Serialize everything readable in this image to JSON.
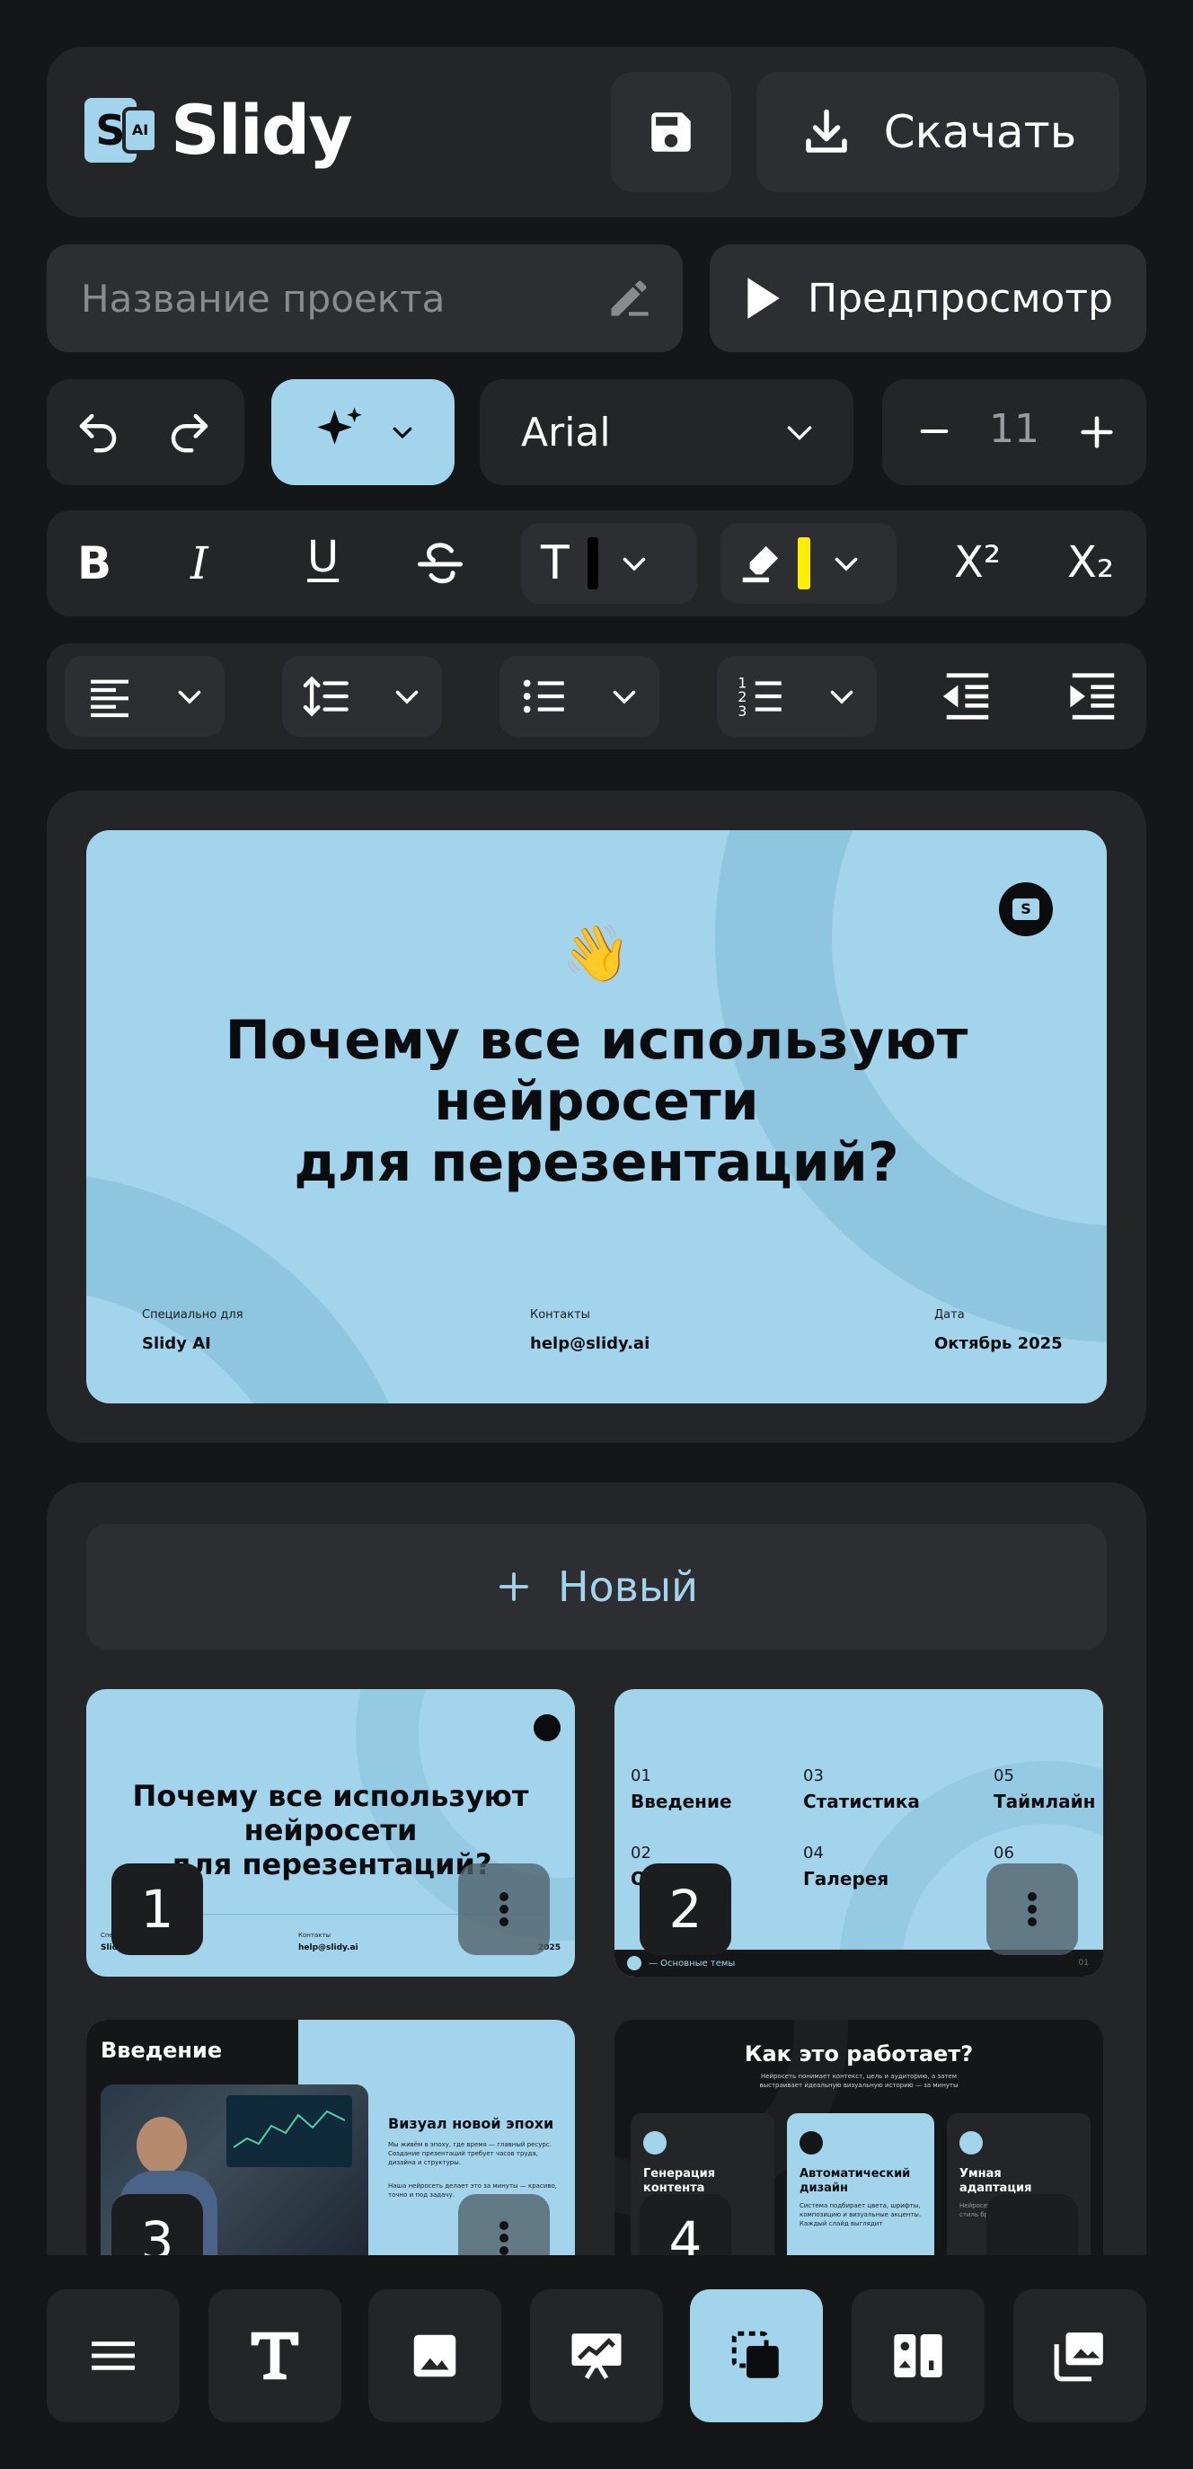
{
  "app": {
    "name": "Slidy",
    "logo_text": "S",
    "logo_badge": "AI"
  },
  "header": {
    "download_label": "Скачать"
  },
  "project": {
    "name_placeholder": "Название проекта",
    "preview_label": "Предпросмотр"
  },
  "toolbar": {
    "font_family": "Arial",
    "font_size": "11",
    "text_color": "#000000",
    "highlight_color": "#ffee00",
    "superscript_label": "X²",
    "subscript_label": "X₂"
  },
  "slide": {
    "emoji": "👋",
    "title": "Почему все используют\nнейросети\nдля перезентаций?",
    "meta": [
      {
        "label": "Специально для",
        "value": "Slidy AI"
      },
      {
        "label": "Контакты",
        "value": "help@slidy.ai"
      },
      {
        "label": "Дата",
        "value": "Октябрь 2025"
      }
    ]
  },
  "slides_panel": {
    "new_label": "Новый",
    "thumbs": [
      {
        "number": "1",
        "title": "Почему все используют\nнейросети\nдля перезентаций?",
        "meta_left": "Специально для",
        "meta_left_value": "Slidy AI",
        "meta_mid": "Контакты",
        "meta_mid_value": "help@slidy.ai",
        "meta_right_value": "2025"
      },
      {
        "number": "2",
        "toc": [
          {
            "num": "01",
            "title": "Введение"
          },
          {
            "num": "03",
            "title": "Статистика"
          },
          {
            "num": "05",
            "title": "Таймлайн"
          },
          {
            "num": "02",
            "title": "О"
          },
          {
            "num": "04",
            "title": "Галерея"
          },
          {
            "num": "06",
            "title": ""
          }
        ],
        "footer": "— Основные темы",
        "page": "01"
      },
      {
        "number": "3",
        "heading": "Введение",
        "sub": "Визуал новой эпохи",
        "p1": "Мы живём в эпоху, где время — главный ресурс. Создание презентаций требует часов труда, дизайна и структуры.",
        "p2": "Наша нейросеть делает это за минуты — красиво, точно и под задачу."
      },
      {
        "number": "4",
        "heading": "Как это работает?",
        "sub": "Нейросеть понимает контекст, цель и аудиторию, а затем выстраивает идеальную визуальную историю — за минуты",
        "cards": [
          {
            "title": "Генерация контента",
            "text": ""
          },
          {
            "title": "Автоматический дизайн",
            "text": "Система подбирает цвета, шрифты, композицию и визуальные акценты. Каждый слайд выглядит"
          },
          {
            "title": "Умная адаптация",
            "text": "Нейросеть примен стиль бре"
          }
        ]
      }
    ]
  },
  "colors": {
    "accent": "#a2d5ec",
    "background": "#151617",
    "panel": "#242527",
    "button": "#2d2e31"
  },
  "bottom_nav": [
    "menu-icon",
    "text-icon",
    "image-icon",
    "chart-icon",
    "layers-icon",
    "layout-icon",
    "gallery-icon"
  ]
}
